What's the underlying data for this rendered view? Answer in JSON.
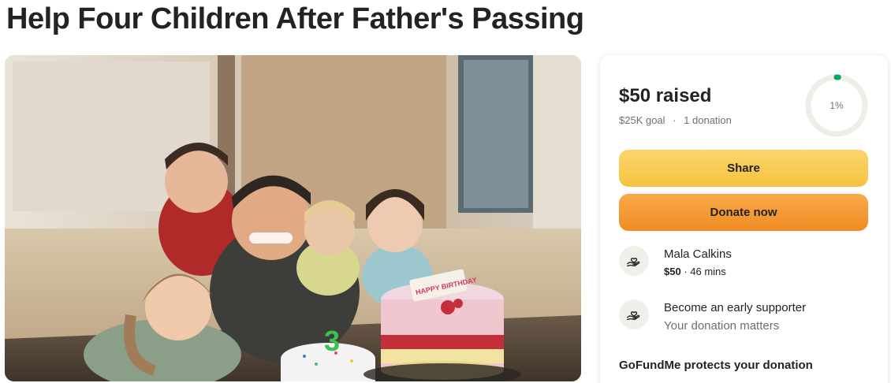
{
  "page": {
    "title": "Help Four Children After Father's Passing"
  },
  "photo": {
    "alt": "Father with four children around birthday cakes",
    "cake_topper_digit": "3",
    "banner_text": "HAPPY BIRTHDAY"
  },
  "donation_card": {
    "raised_label": "$50 raised",
    "goal_label": "$25K goal",
    "separator": "·",
    "donations_label": "1 donation",
    "progress_percent_label": "1%",
    "progress_fraction": 0.01,
    "share_button": "Share",
    "donate_button": "Donate now",
    "recent_donation": {
      "name": "Mala Calkins",
      "amount": "$50",
      "time": " · 46 mins"
    },
    "early_supporter": {
      "title": "Become an early supporter",
      "subtitle": "Your donation matters"
    },
    "protects_text": "GoFundMe protects your donation"
  },
  "colors": {
    "share_button": "#f4c33f",
    "donate_button": "#f08c22",
    "progress_accent": "#02a95c",
    "ring_track": "#efede8"
  },
  "icons": {
    "donor_icon": "hand-heart-icon",
    "supporter_icon": "hand-heart-icon"
  }
}
